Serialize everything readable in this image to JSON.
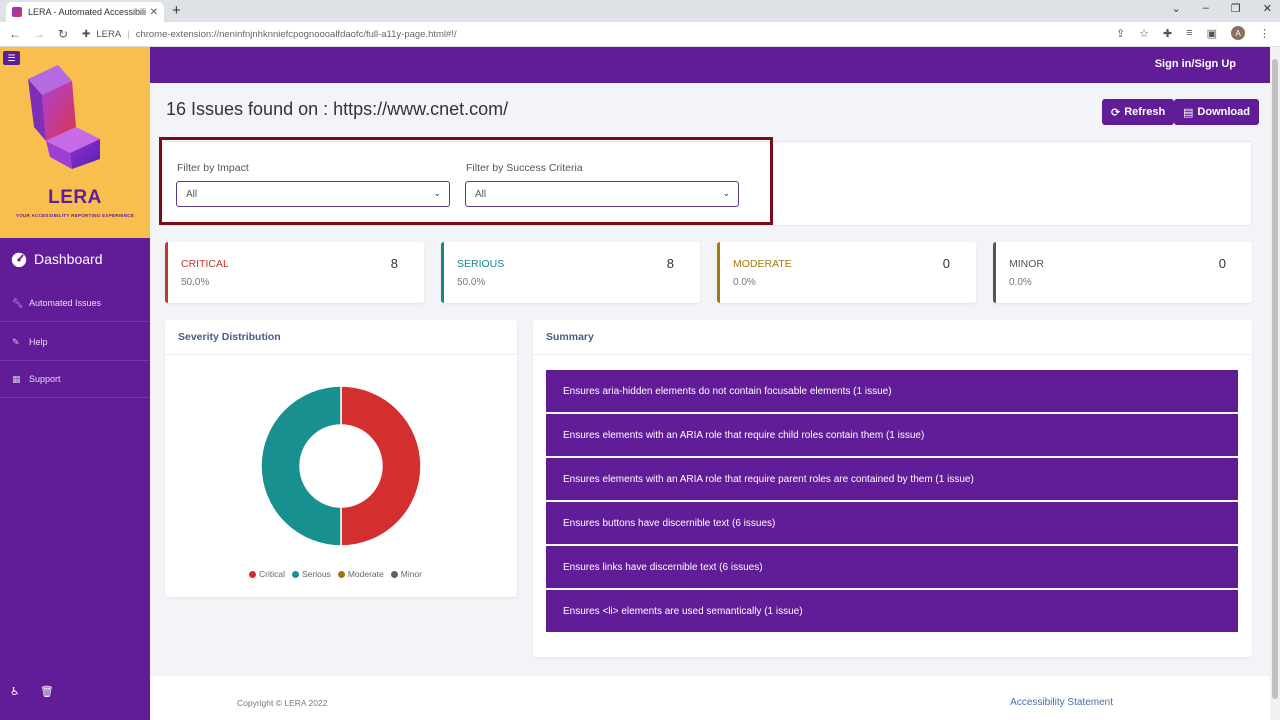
{
  "browser": {
    "tab_title": "LERA - Automated Accessibility T",
    "tab_close": "✕",
    "new_tab": "+",
    "site_label": "LERA",
    "url": "chrome-extension://neninfnjnhknniefcpognoooalfdaofc/full-a11y-page.html#!/",
    "avatar_letter": "A"
  },
  "brand": {
    "name": "LERA",
    "tagline": "YOUR ACCESSIBILITY REPORTING EXPERIENCE"
  },
  "sidebar": {
    "dashboard_label": "Dashboard",
    "items": [
      {
        "label": "Automated Issues",
        "icon": "wrench-icon"
      },
      {
        "label": "Help",
        "icon": "pencil-icon"
      },
      {
        "label": "Support",
        "icon": "table-icon"
      }
    ]
  },
  "header": {
    "signin_label": "Sign in/Sign Up"
  },
  "main": {
    "title": "16 Issues found on : https://www.cnet.com/",
    "refresh_label": "Refresh",
    "download_label": "Download"
  },
  "filters": {
    "impact_label": "Filter by Impact",
    "impact_value": "All",
    "criteria_label": "Filter by Success Criteria",
    "criteria_value": "All"
  },
  "cards": [
    {
      "label": "CRITICAL",
      "count": "8",
      "percent": "50.0%",
      "color": "#c0392b"
    },
    {
      "label": "SERIOUS",
      "count": "8",
      "percent": "50.0%",
      "color": "#17868a"
    },
    {
      "label": "MODERATE",
      "count": "0",
      "percent": "0.0%",
      "color": "#a47a0c"
    },
    {
      "label": "MINOR",
      "count": "0",
      "percent": "0.0%",
      "color": "#555555"
    }
  ],
  "severity": {
    "title": "Severity Distribution"
  },
  "chart_data": {
    "type": "pie",
    "categories": [
      "Critical",
      "Serious",
      "Moderate",
      "Minor"
    ],
    "values": [
      8,
      8,
      0,
      0
    ],
    "colors": [
      "#d32f2f",
      "#17908f",
      "#a0760a",
      "#616161"
    ]
  },
  "summary": {
    "title": "Summary",
    "items": [
      "Ensures aria-hidden elements do not contain focusable elements (1 issue)",
      "Ensures elements with an ARIA role that require child roles contain them (1 issue)",
      "Ensures elements with an ARIA role that require parent roles are contained by them (1 issue)",
      "Ensures buttons have discernible text (6 issues)",
      "Ensures links have discernible text (6 issues)",
      "Ensures <li> elements are used semantically (1 issue)"
    ]
  },
  "footer": {
    "copyright": "Copyright © LERA 2022",
    "a11y_link": "Accessibility Statement"
  }
}
